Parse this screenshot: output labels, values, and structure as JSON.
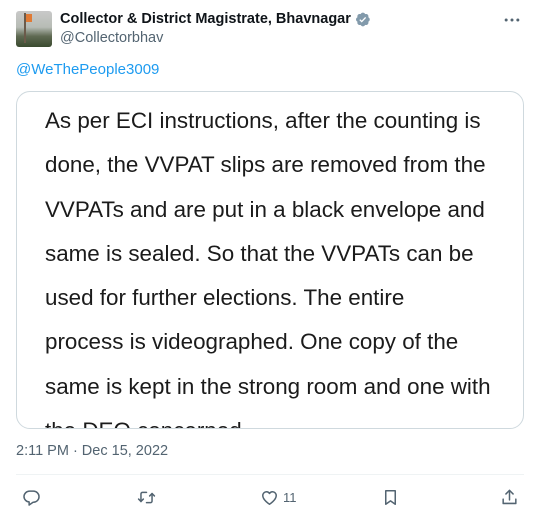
{
  "tweet": {
    "author": {
      "display_name": "Collector & District Magistrate, Bhavnagar",
      "handle": "@Collectorbhav",
      "verified_badge_icon": "verified-badge-icon"
    },
    "reply_to": "@WeThePeople3009",
    "media_text_lines": [
      "As per ECI instructions,  after the counting is",
      "done, the VVPAT slips are removed from the",
      "VVPATs and are put in a black envelope and",
      "same is sealed. So that the VVPATs can be",
      "used for further elections.  The entire",
      "process is videographed. One copy of the",
      "same is kept in the strong room and one with",
      "the DEO concerned."
    ],
    "timestamp": "2:11 PM · Dec 15, 2022",
    "actions": {
      "reply": {
        "icon": "reply-icon",
        "count": ""
      },
      "repost": {
        "icon": "repost-icon",
        "count": ""
      },
      "like": {
        "icon": "heart-icon",
        "count": "11"
      },
      "bookmark": {
        "icon": "bookmark-icon",
        "count": ""
      },
      "share": {
        "icon": "share-icon",
        "count": ""
      }
    },
    "more_icon": "more-icon"
  },
  "colors": {
    "accent": "#1d9bf0",
    "secondary_text": "#536471",
    "primary_text": "#0f1419",
    "border": "#cfd9de",
    "verified_badge": "#829aab"
  }
}
